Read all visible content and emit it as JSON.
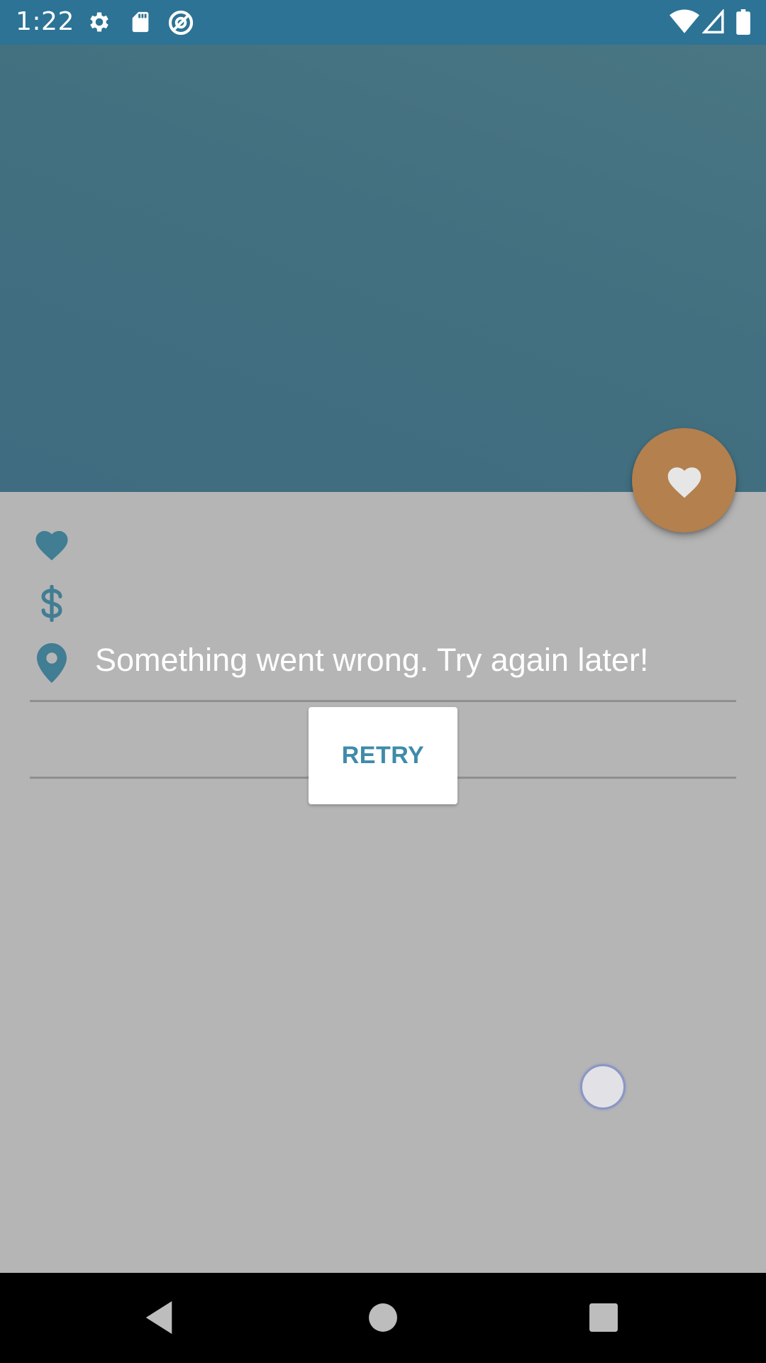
{
  "status_bar": {
    "time": "1:22",
    "icons_left": [
      "gear-icon",
      "sd-card-icon",
      "no-disturb-icon"
    ],
    "icons_right": [
      "wifi-icon",
      "signal-icon",
      "battery-icon"
    ],
    "background_color": "#2c7395"
  },
  "header": {
    "background_color": "#427080"
  },
  "fab": {
    "icon": "heart-icon",
    "color": "#b3804e"
  },
  "details": {
    "rows": [
      {
        "icon": "heart-icon",
        "text": ""
      },
      {
        "icon": "dollar-icon",
        "text": ""
      },
      {
        "icon": "location-pin-icon",
        "text": "Something went wrong. Try again later!"
      }
    ],
    "accent_color": "#417d93"
  },
  "retry": {
    "label": "RETRY",
    "color": "#3f8ba9"
  },
  "nav_bar": {
    "buttons": [
      "back-icon",
      "home-icon",
      "recents-icon"
    ]
  }
}
